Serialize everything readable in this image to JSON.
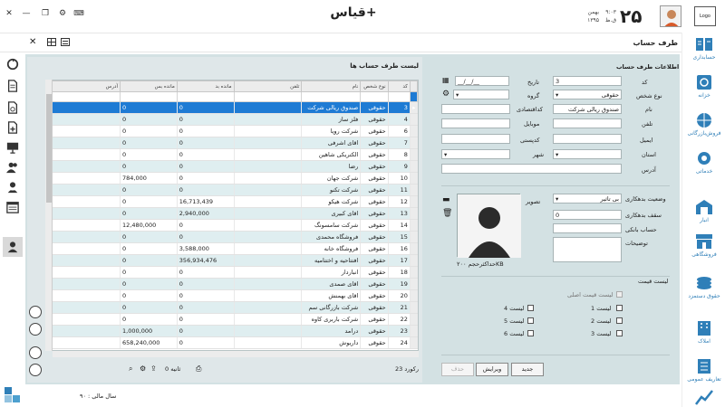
{
  "app": {
    "title": "قیاس+",
    "logo_text": "Logo",
    "day": "۲۵",
    "month": "بهمن",
    "year": "۱۳۹۵",
    "time": "۹:۰۳",
    "time_sub": "ق.ظ"
  },
  "form": {
    "title": "طرف حساب"
  },
  "nav": {
    "items": [
      {
        "label": "حسابداری",
        "icon": "accounting-icon"
      },
      {
        "label": "خزانه",
        "icon": "treasury-icon"
      },
      {
        "label": "فروش‌بازرگانی",
        "icon": "globe-cart-icon"
      },
      {
        "label": "خدماتی",
        "icon": "gear-icon"
      },
      {
        "label": "انبار",
        "icon": "warehouse-icon"
      },
      {
        "label": "فروشگاهی",
        "icon": "store-icon"
      },
      {
        "label": "حقوق دستمزد",
        "icon": "money-stack-icon"
      },
      {
        "label": "املاک",
        "icon": "building-icon"
      },
      {
        "label": "تعاریف عمومی",
        "icon": "list-doc-icon"
      },
      {
        "label": "",
        "icon": "chart-icon"
      }
    ]
  },
  "list": {
    "title": "لیست طرف حساب ها",
    "columns": [
      "کد",
      "نوع شخص",
      "نام",
      "تلفن",
      "مانده بد",
      "مانده بس",
      "آدرس"
    ],
    "rows": [
      {
        "code": "3",
        "type": "حقوقی",
        "name": "صندوق ریالی شرکت",
        "phone": "",
        "debit": "0",
        "credit": "0",
        "addr": ""
      },
      {
        "code": "4",
        "type": "حقوقی",
        "name": "فلز ساز",
        "phone": "",
        "debit": "0",
        "credit": "0",
        "addr": ""
      },
      {
        "code": "6",
        "type": "حقوقی",
        "name": "شرکت رویا",
        "phone": "",
        "debit": "0",
        "credit": "0",
        "addr": ""
      },
      {
        "code": "7",
        "type": "حقوقی",
        "name": "اقای اشرفی",
        "phone": "",
        "debit": "0",
        "credit": "0",
        "addr": ""
      },
      {
        "code": "8",
        "type": "حقوقی",
        "name": "الکتریکی شاهین",
        "phone": "",
        "debit": "0",
        "credit": "0",
        "addr": ""
      },
      {
        "code": "9",
        "type": "حقوقی",
        "name": "رضا",
        "phone": "",
        "debit": "0",
        "credit": "0",
        "addr": ""
      },
      {
        "code": "10",
        "type": "حقوقی",
        "name": "شرکت جهان",
        "phone": "",
        "debit": "0",
        "credit": "784,000",
        "addr": ""
      },
      {
        "code": "11",
        "type": "حقوقی",
        "name": "شرکت تکنو",
        "phone": "",
        "debit": "0",
        "credit": "0",
        "addr": ""
      },
      {
        "code": "12",
        "type": "حقوقی",
        "name": "شرکت هیکو",
        "phone": "",
        "debit": "16,713,439",
        "credit": "0",
        "addr": ""
      },
      {
        "code": "13",
        "type": "حقوقی",
        "name": "اقای کبیری",
        "phone": "",
        "debit": "2,940,000",
        "credit": "0",
        "addr": ""
      },
      {
        "code": "14",
        "type": "حقوقی",
        "name": "شرکت سامسونگ",
        "phone": "",
        "debit": "0",
        "credit": "12,480,000",
        "addr": ""
      },
      {
        "code": "15",
        "type": "حقوقی",
        "name": "فروشگاه محمدی",
        "phone": "",
        "debit": "0",
        "credit": "0",
        "addr": ""
      },
      {
        "code": "16",
        "type": "حقوقی",
        "name": "فروشگاه خانه",
        "phone": "",
        "debit": "3,588,000",
        "credit": "0",
        "addr": ""
      },
      {
        "code": "17",
        "type": "حقوقی",
        "name": "افتتاحیه و اختتامیه",
        "phone": "",
        "debit": "356,934,476",
        "credit": "0",
        "addr": ""
      },
      {
        "code": "18",
        "type": "حقوقی",
        "name": "انباردار",
        "phone": "",
        "debit": "0",
        "credit": "0",
        "addr": ""
      },
      {
        "code": "19",
        "type": "حقوقی",
        "name": "اقای صمدی",
        "phone": "",
        "debit": "0",
        "credit": "0",
        "addr": ""
      },
      {
        "code": "20",
        "type": "حقوقی",
        "name": "اقای بهمنش",
        "phone": "",
        "debit": "0",
        "credit": "0",
        "addr": ""
      },
      {
        "code": "21",
        "type": "حقوقی",
        "name": "شرکت بازرگانی سم",
        "phone": "",
        "debit": "0",
        "credit": "0",
        "addr": ""
      },
      {
        "code": "22",
        "type": "حقوقی",
        "name": "شرکت  باربری کاوه",
        "phone": "",
        "debit": "0",
        "credit": "0",
        "addr": ""
      },
      {
        "code": "23",
        "type": "حقوقی",
        "name": "درامد",
        "phone": "",
        "debit": "0",
        "credit": "1,000,000",
        "addr": ""
      },
      {
        "code": "24",
        "type": "حقوقی",
        "name": "داریوش",
        "phone": "",
        "debit": "0",
        "credit": "658,240,000",
        "addr": ""
      }
    ],
    "record_count": "23 رکورد",
    "seconds": "0 ثانیه"
  },
  "detail": {
    "section_title": "اطلاعات طرف حساب",
    "code_label": "کد",
    "code_value": "3",
    "date_label": "تاریخ",
    "date_value": "__/__/__",
    "person_type_label": "نوع شخص",
    "person_type_value": "حقوقی",
    "group_label": "گروه",
    "name_label": "نام",
    "name_value": "صندوق ریالی شرکت",
    "economic_code_label": "کداقتصادی",
    "phone_label": "تلفن",
    "mobile_label": "موبایل",
    "email_label": "ایمیل",
    "postal_label": "کدپستی",
    "province_label": "استان",
    "city_label": "شهر",
    "address_label": "آدرس",
    "debt_status_label": "وضعیت بدهکاری",
    "debt_status_value": "بی تاثیر",
    "debt_ceiling_label": "سقف بدهکاری",
    "debt_ceiling_value": "0",
    "bank_account_label": "حساب بانکی",
    "notes_label": "توضیحات",
    "image_label": "تصویر",
    "image_size": "حداکثرحجم ۲۰۰KB",
    "price_list_title": "لیست قیمت",
    "price_main_label": "لیست قیمت اصلی",
    "price_lists": [
      "لیست 1",
      "لیست 2",
      "لیست 3",
      "لیست 4",
      "لیست 5",
      "لیست 6"
    ],
    "new_button": "جدید",
    "edit_button": "ویرایش",
    "delete_button": "حذف"
  },
  "status": {
    "fiscal_year": "سال مالی : ۹۰"
  }
}
